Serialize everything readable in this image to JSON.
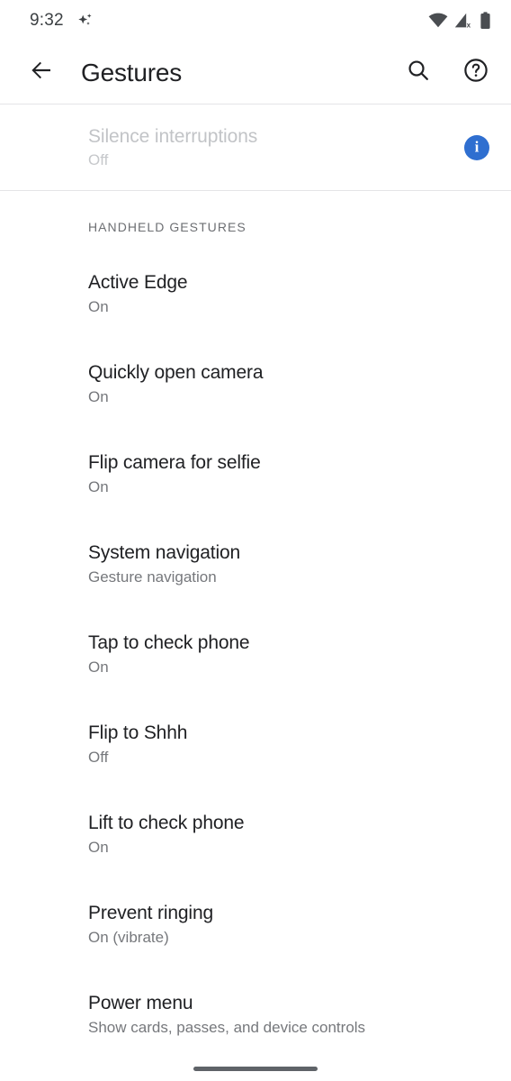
{
  "status_bar": {
    "time": "9:32",
    "left_icons": [
      {
        "name": "sparkle-icon",
        "label": "sparkle"
      }
    ],
    "right_icons": [
      {
        "name": "wifi-icon",
        "label": "wifi"
      },
      {
        "name": "mobile-signal-off-icon",
        "label": "no-sim"
      },
      {
        "name": "battery-icon",
        "label": "battery"
      }
    ]
  },
  "toolbar": {
    "back_label": "Back",
    "title": "Gestures",
    "search_label": "Search",
    "help_label": "Help"
  },
  "disabled_preference": {
    "title": "Silence interruptions",
    "summary": "Off",
    "info_glyph": "i",
    "info_color": "#2f6fd0"
  },
  "section": {
    "header": "HANDHELD GESTURES"
  },
  "preferences": [
    {
      "title": "Active Edge",
      "summary": "On"
    },
    {
      "title": "Quickly open camera",
      "summary": "On"
    },
    {
      "title": "Flip camera for selfie",
      "summary": "On"
    },
    {
      "title": "System navigation",
      "summary": "Gesture navigation"
    },
    {
      "title": "Tap to check phone",
      "summary": "On"
    },
    {
      "title": "Flip to Shhh",
      "summary": "Off"
    },
    {
      "title": "Lift to check phone",
      "summary": "On"
    },
    {
      "title": "Prevent ringing",
      "summary": "On (vibrate)"
    },
    {
      "title": "Power menu",
      "summary": "Show cards, passes, and device controls"
    }
  ],
  "navigation_bar": {
    "pill_label": "Home gesture pill"
  },
  "colors": {
    "background": "#ffffff",
    "primary_text": "#202124",
    "secondary_text": "#76787c",
    "disabled_text": "#c2c4c7",
    "divider": "#e4e5e7",
    "accent_blue": "#2f6fd0"
  }
}
